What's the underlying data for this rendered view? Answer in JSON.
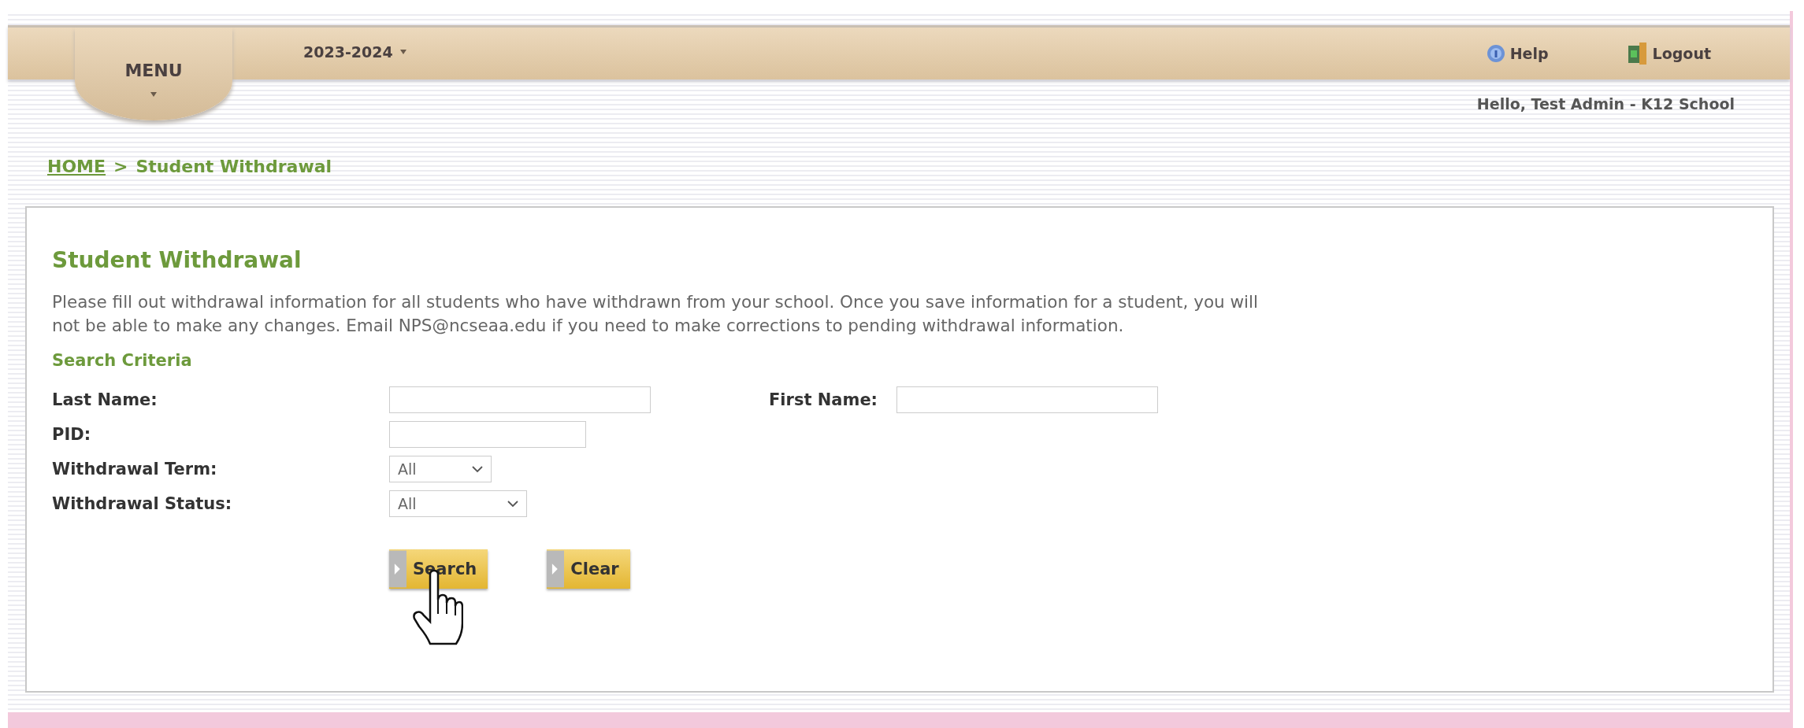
{
  "header": {
    "menu": "MENU",
    "year": "2023-2024",
    "links": [
      {
        "kind": "help",
        "label": "Help"
      },
      {
        "kind": "logout",
        "label": "Logout"
      }
    ],
    "greeting": "Hello, Test Admin - K12 School"
  },
  "breadcrumb": {
    "home": "HOME",
    "separator": ">",
    "current": "Student Withdrawal"
  },
  "panel": {
    "title": "Student Withdrawal",
    "description": "Please fill out withdrawal information for all students who have withdrawn from your school. Once you save information for a student, you will not be able to make any changes. Email NPS@ncseaa.edu if you need to make corrections to pending withdrawal information.",
    "section": "Search Criteria",
    "rows": [
      {
        "fields": [
          {
            "label": "Last Name:",
            "kind": "text"
          },
          {
            "label": "First Name:",
            "kind": "text"
          }
        ]
      },
      {
        "fields": [
          {
            "label": "PID:",
            "kind": "text"
          }
        ]
      },
      {
        "fields": [
          {
            "label": "Withdrawal Term:",
            "kind": "select",
            "value": "All"
          }
        ]
      },
      {
        "fields": [
          {
            "label": "Withdrawal Status:",
            "kind": "select",
            "value": "All"
          }
        ]
      }
    ],
    "buttons": [
      {
        "label": "Search",
        "pointer": true
      },
      {
        "label": "Clear",
        "pointer": false
      }
    ]
  }
}
